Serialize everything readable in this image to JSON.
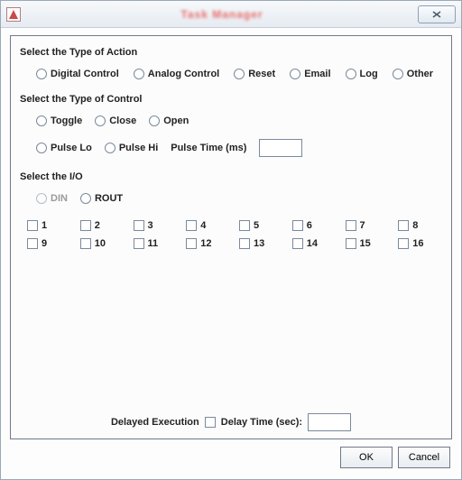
{
  "window": {
    "title": "Task Manager"
  },
  "sections": {
    "action": {
      "label": "Select the Type of Action",
      "options": [
        "Digital Control",
        "Analog Control",
        "Reset",
        "Email",
        "Log",
        "Other"
      ]
    },
    "control": {
      "label": "Select the Type of Control",
      "row1": [
        "Toggle",
        "Close",
        "Open"
      ],
      "row2": [
        "Pulse Lo",
        "Pulse Hi"
      ],
      "pulse_time_label": "Pulse Time (ms)",
      "pulse_time_value": ""
    },
    "io": {
      "label": "Select the I/O",
      "radios": [
        {
          "label": "DIN",
          "disabled": true
        },
        {
          "label": "ROUT",
          "disabled": false
        }
      ],
      "channels": [
        "1",
        "2",
        "3",
        "4",
        "5",
        "6",
        "7",
        "8",
        "9",
        "10",
        "11",
        "12",
        "13",
        "14",
        "15",
        "16"
      ]
    }
  },
  "footer": {
    "delayed_label": "Delayed Execution",
    "delay_time_label": "Delay Time (sec):",
    "delay_time_value": ""
  },
  "buttons": {
    "ok": "OK",
    "cancel": "Cancel"
  }
}
